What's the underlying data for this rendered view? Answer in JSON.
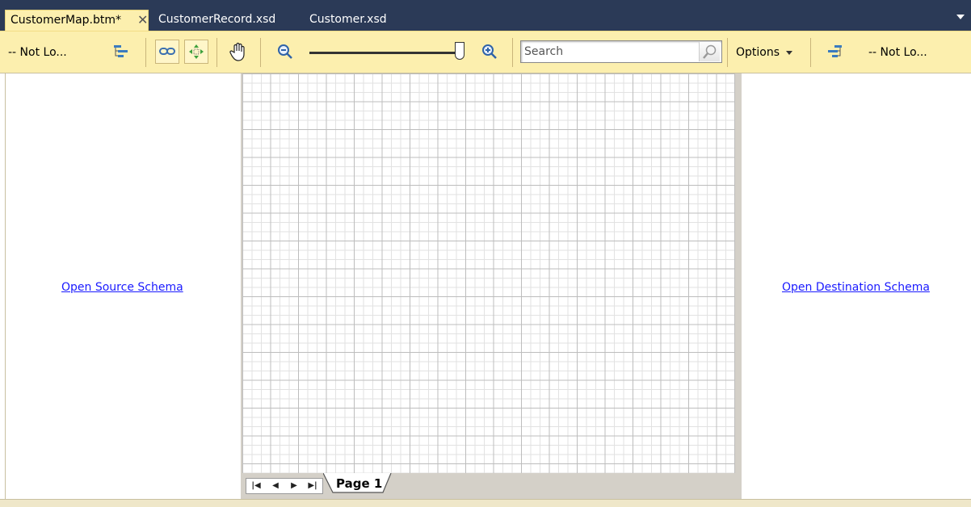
{
  "tabs": [
    {
      "label": "CustomerMap.btm*",
      "active": true
    },
    {
      "label": "CustomerRecord.xsd",
      "active": false
    },
    {
      "label": "Customer.xsd",
      "active": false
    }
  ],
  "toolbar": {
    "source_combo": "-- Not Lo...",
    "destination_combo": "-- Not Lo...",
    "search_placeholder": "Search",
    "options_label": "Options",
    "icons": [
      "source-schema-icon",
      "link-icon",
      "relevance-icon",
      "pan-hand-icon",
      "zoom-out-icon",
      "zoom-slider",
      "zoom-in-icon",
      "search-icon",
      "destination-schema-icon"
    ]
  },
  "panes": {
    "source_link": "Open Source Schema",
    "destination_link": "Open Destination Schema"
  },
  "grid": {
    "page_tab": "Page 1",
    "nav": [
      "|◀",
      "◀",
      "▶",
      "▶|"
    ]
  },
  "colors": {
    "tab_strip": "#2b3a57",
    "active_tab": "#fcefae",
    "toolbar": "#fcefae",
    "link": "#1a1aff"
  }
}
